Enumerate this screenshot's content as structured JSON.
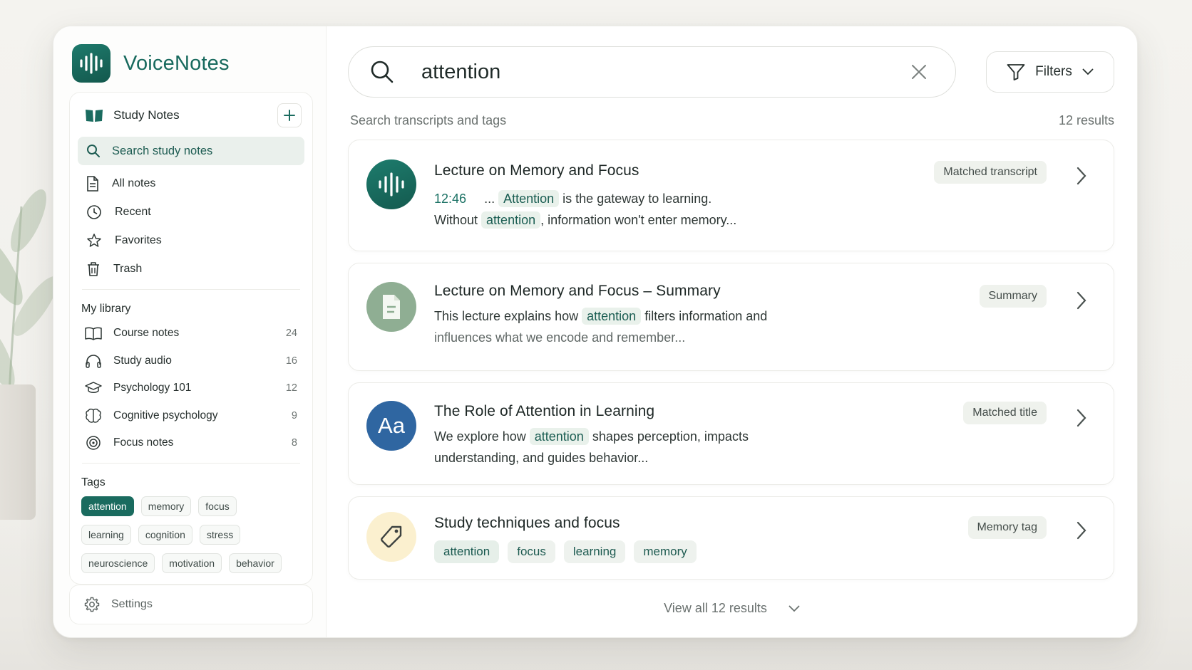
{
  "brand": {
    "name": "VoiceNotes"
  },
  "sidebar": {
    "notebook_title": "Study Notes",
    "search_label": "Search study notes",
    "nav": [
      {
        "label": "All notes",
        "icon": "document-icon"
      },
      {
        "label": "Recent",
        "icon": "clock-icon"
      },
      {
        "label": "Favorites",
        "icon": "star-icon"
      },
      {
        "label": "Trash",
        "icon": "trash-icon"
      }
    ],
    "library_title": "My library",
    "library": [
      {
        "label": "Course notes",
        "count": "24",
        "icon": "book-open-icon"
      },
      {
        "label": "Study audio",
        "count": "16",
        "icon": "headphones-icon"
      },
      {
        "label": "Psychology 101",
        "count": "12",
        "icon": "graduation-cap-icon"
      },
      {
        "label": "Cognitive psychology",
        "count": "9",
        "icon": "brain-icon"
      },
      {
        "label": "Focus notes",
        "count": "8",
        "icon": "target-icon"
      }
    ],
    "tags_title": "Tags",
    "tags": [
      "attention",
      "memory",
      "focus",
      "learning",
      "cognition",
      "stress",
      "neuroscience",
      "motivation",
      "behavior"
    ],
    "active_tag": "attention",
    "settings_label": "Settings"
  },
  "search": {
    "query": "attention",
    "hint": "Search transcripts and tags",
    "results_count": "12 results",
    "filters_label": "Filters"
  },
  "results": [
    {
      "title": "Lecture on Memory and Focus",
      "badge": "Matched transcript",
      "timestamp": "12:46",
      "line1_prefix": "...",
      "line1_hl": "Attention",
      "line1_suffix": "is the gateway to learning.",
      "line2_prefix": "Without",
      "line2_hl": "attention",
      "line2_suffix": ", information won't enter memory..."
    },
    {
      "title": "Lecture on Memory and Focus – Summary",
      "badge": "Summary",
      "line1_prefix": "This lecture explains how",
      "line1_hl": "attention",
      "line1_suffix": "filters information and",
      "line2": "influences what we encode and remember..."
    },
    {
      "title": "The Role of Attention in Learning",
      "badge": "Matched title",
      "avatar_text": "Aa",
      "line1_prefix": "We explore how",
      "line1_hl": "attention",
      "line1_suffix": "shapes perception, impacts",
      "line2": "understanding, and guides behavior..."
    },
    {
      "title": "Study techniques and focus",
      "badge": "Memory tag",
      "chips": [
        "attention",
        "focus",
        "learning",
        "memory"
      ]
    }
  ],
  "view_all_label": "View all 12 results",
  "colors": {
    "brand": "#1a6b5f",
    "highlight": "#e9f1eb",
    "aa_avatar": "#2f66a1"
  }
}
